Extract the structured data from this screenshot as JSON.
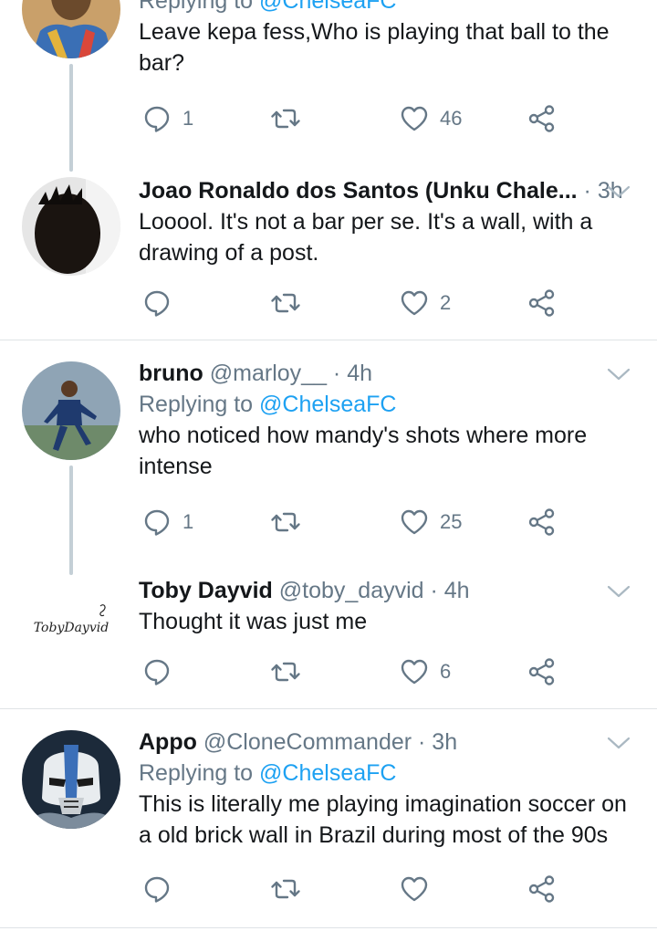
{
  "tweets": [
    {
      "reply_prefix": "Replying to ",
      "reply_mention": "@ChelseaFC",
      "text": "Leave kepa fess,Who is playing that ball to the bar?",
      "replies": "1",
      "retweets": "",
      "likes": "46"
    },
    {
      "name": "Joao Ronaldo dos Santos (Unku Chale...",
      "handle": "",
      "dot": " · ",
      "time": "3h",
      "text": "Looool. It's not a bar per se. It's a wall, with a drawing of a post.",
      "replies": "",
      "retweets": "",
      "likes": "2"
    },
    {
      "name": "bruno",
      "handle": "@marloy__",
      "dot": " · ",
      "time": "4h",
      "reply_prefix": "Replying to ",
      "reply_mention": "@ChelseaFC",
      "text": "who noticed how mandy's shots where more intense",
      "replies": "1",
      "retweets": "",
      "likes": "25"
    },
    {
      "name": "Toby Dayvid",
      "handle": "@toby_dayvid",
      "dot": " · ",
      "time": "4h",
      "avatar_text": "TobyDayvid",
      "text": "Thought it was just me",
      "replies": "",
      "retweets": "",
      "likes": "6"
    },
    {
      "name": "Appo",
      "handle": "@CloneCommander",
      "dot": " · ",
      "time": "3h",
      "reply_prefix": "Replying to ",
      "reply_mention": "@ChelseaFC",
      "text": "This is literally me playing imagination soccer on a old brick wall in Brazil during most of the 90s",
      "replies": "",
      "retweets": "",
      "likes": ""
    }
  ],
  "colors": {
    "accent": "#1da1f2",
    "secondary_text": "#657786",
    "primary_text": "#14171a",
    "thread_line": "#c4cfd6",
    "divider": "#dfe3e6"
  },
  "icons": [
    "reply-icon",
    "retweet-icon",
    "like-icon",
    "share-icon",
    "caret-down-icon"
  ]
}
